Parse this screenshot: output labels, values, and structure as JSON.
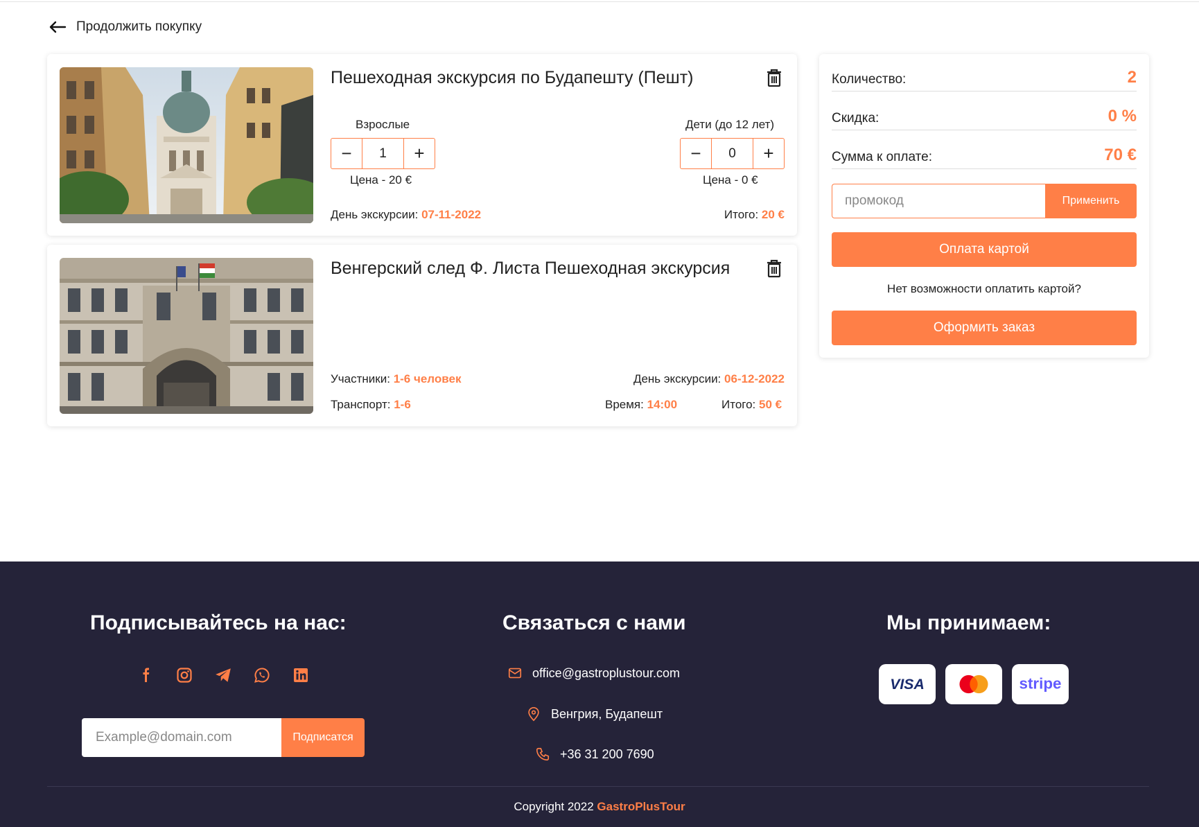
{
  "nav": {
    "back_label": "Продолжить покупку"
  },
  "cart": {
    "items": [
      {
        "title": "Пешеходная экскурсия по Будапешту (Пешт)",
        "adults": {
          "label": "Взрослые",
          "value": "1",
          "price": "Цена - 20 €"
        },
        "children": {
          "label": "Дети (до 12 лет)",
          "value": "0",
          "price": "Цена - 0 €"
        },
        "day_label": "День экскурсии:",
        "day_value": "07-11-2022",
        "total_label": "Итого:",
        "total_value": "20 €"
      },
      {
        "title": "Венгерский след Ф. Листа Пешеходная экскурсия",
        "participants_label": "Участники:",
        "participants_value": "1-6 человек",
        "transport_label": "Транспорт:",
        "transport_value": "1-6",
        "day_label": "День экскурсии:",
        "day_value": "06-12-2022",
        "time_label": "Время:",
        "time_value": "14:00",
        "total_label": "Итого:",
        "total_value": "50 €"
      }
    ]
  },
  "summary": {
    "quantity_label": "Количество:",
    "quantity_value": "2",
    "discount_label": "Скидка:",
    "discount_value": "0 %",
    "sum_label": "Сумма к оплате:",
    "sum_value": "70 €",
    "promo_placeholder": "промокод",
    "apply_label": "Применить",
    "pay_card_label": "Оплата картой",
    "no_card_text": "Нет возможности оплатить картой?",
    "order_label": "Оформить заказ"
  },
  "footer": {
    "subscribe_heading": "Подписывайтесь на нас:",
    "social_icons": [
      "facebook-icon",
      "instagram-icon",
      "telegram-icon",
      "whatsapp-icon",
      "linkedin-icon"
    ],
    "email_placeholder": "Example@domain.com",
    "subscribe_button": "Подписатся",
    "contact_heading": "Связаться с нами",
    "email": "office@gastroplustour.com",
    "address": "Венгрия, Будапешт",
    "phone": "+36 31 200 7690",
    "accept_heading": "Мы принимаем:",
    "payment_methods": [
      "VISA",
      "Mastercard",
      "stripe"
    ],
    "copyright_prefix": "Copyright 2022",
    "brand": "GastroPlusTour"
  },
  "colors": {
    "accent": "#ff7f47",
    "footer_bg": "#252339"
  }
}
